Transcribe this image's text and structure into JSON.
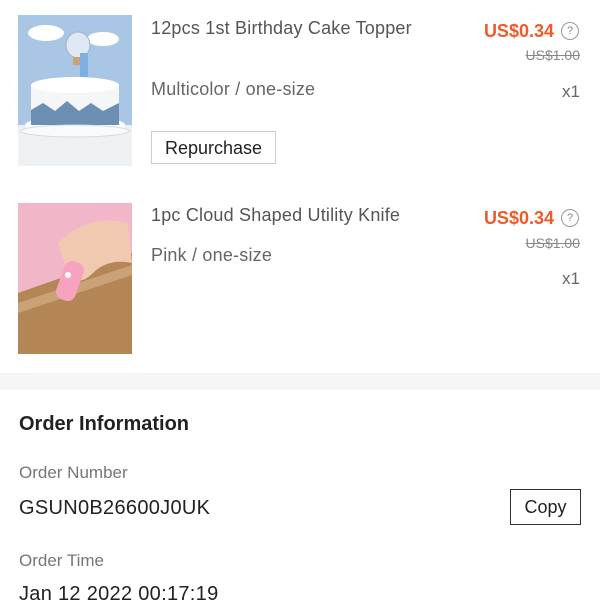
{
  "items": [
    {
      "title": "12pcs 1st Birthday Cake Topper",
      "variant": "Multicolor / one-size",
      "price": "US$0.34",
      "original_price": "US$1.00",
      "quantity": "x1",
      "repurchase_label": "Repurchase",
      "image": "birthday-cake-image"
    },
    {
      "title": "1pc Cloud Shaped Utility Knife",
      "variant": "Pink / one-size",
      "price": "US$0.34",
      "original_price": "US$1.00",
      "quantity": "x1",
      "image": "utility-knife-image"
    }
  ],
  "help_icon_glyph": "?",
  "order_info": {
    "title": "Order Information",
    "order_number_label": "Order Number",
    "order_number": "GSUN0B26600J0UK",
    "copy_label": "Copy",
    "order_time_label": "Order Time",
    "order_time": "Jan 12 2022 00:17:19"
  },
  "colors": {
    "price": "#f05a28",
    "divider_band": "#f5f5f5"
  }
}
